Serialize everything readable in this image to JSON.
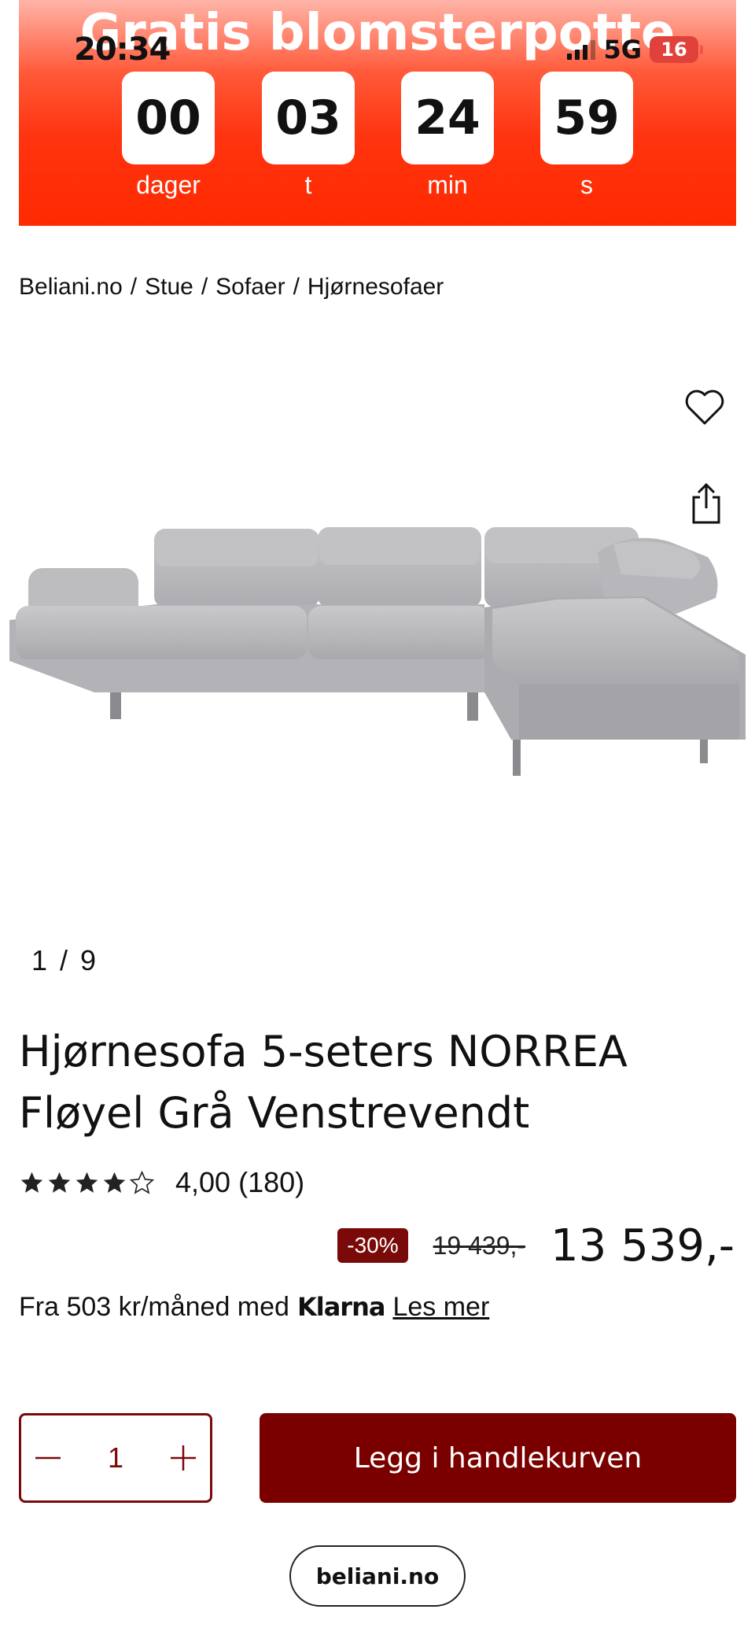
{
  "status_bar": {
    "time": "20:34",
    "network": "5G",
    "battery": "16"
  },
  "promo": {
    "title": "Gratis blomsterpotte",
    "countdown": [
      {
        "value": "00",
        "label": "dager"
      },
      {
        "value": "03",
        "label": "t"
      },
      {
        "value": "24",
        "label": "min"
      },
      {
        "value": "59",
        "label": "s"
      }
    ]
  },
  "breadcrumb": [
    "Beliani.no",
    "Stue",
    "Sofaer",
    "Hjørnesofaer"
  ],
  "gallery": {
    "current": "1",
    "separator": "/",
    "total": "9"
  },
  "product": {
    "title": "Hjørnesofa 5-seters NORREA Fløyel Grå Venstrevendt",
    "rating_value": "4,00",
    "rating_count": "(180)",
    "rating_stars": 4,
    "discount": "-30%",
    "old_price": "19 439,-",
    "price": "13 539,-"
  },
  "klarna": {
    "text": "Fra 503 kr/måned med",
    "brand": "Klarna",
    "link": "Les mer"
  },
  "cart": {
    "quantity": "1",
    "add_label": "Legg i handlekurven"
  },
  "browser": {
    "url": "beliani.no"
  },
  "colors": {
    "brand_dark_red": "#7a0000",
    "banner_red": "#ff3410",
    "sofa_grey": "#b9b9bc"
  }
}
